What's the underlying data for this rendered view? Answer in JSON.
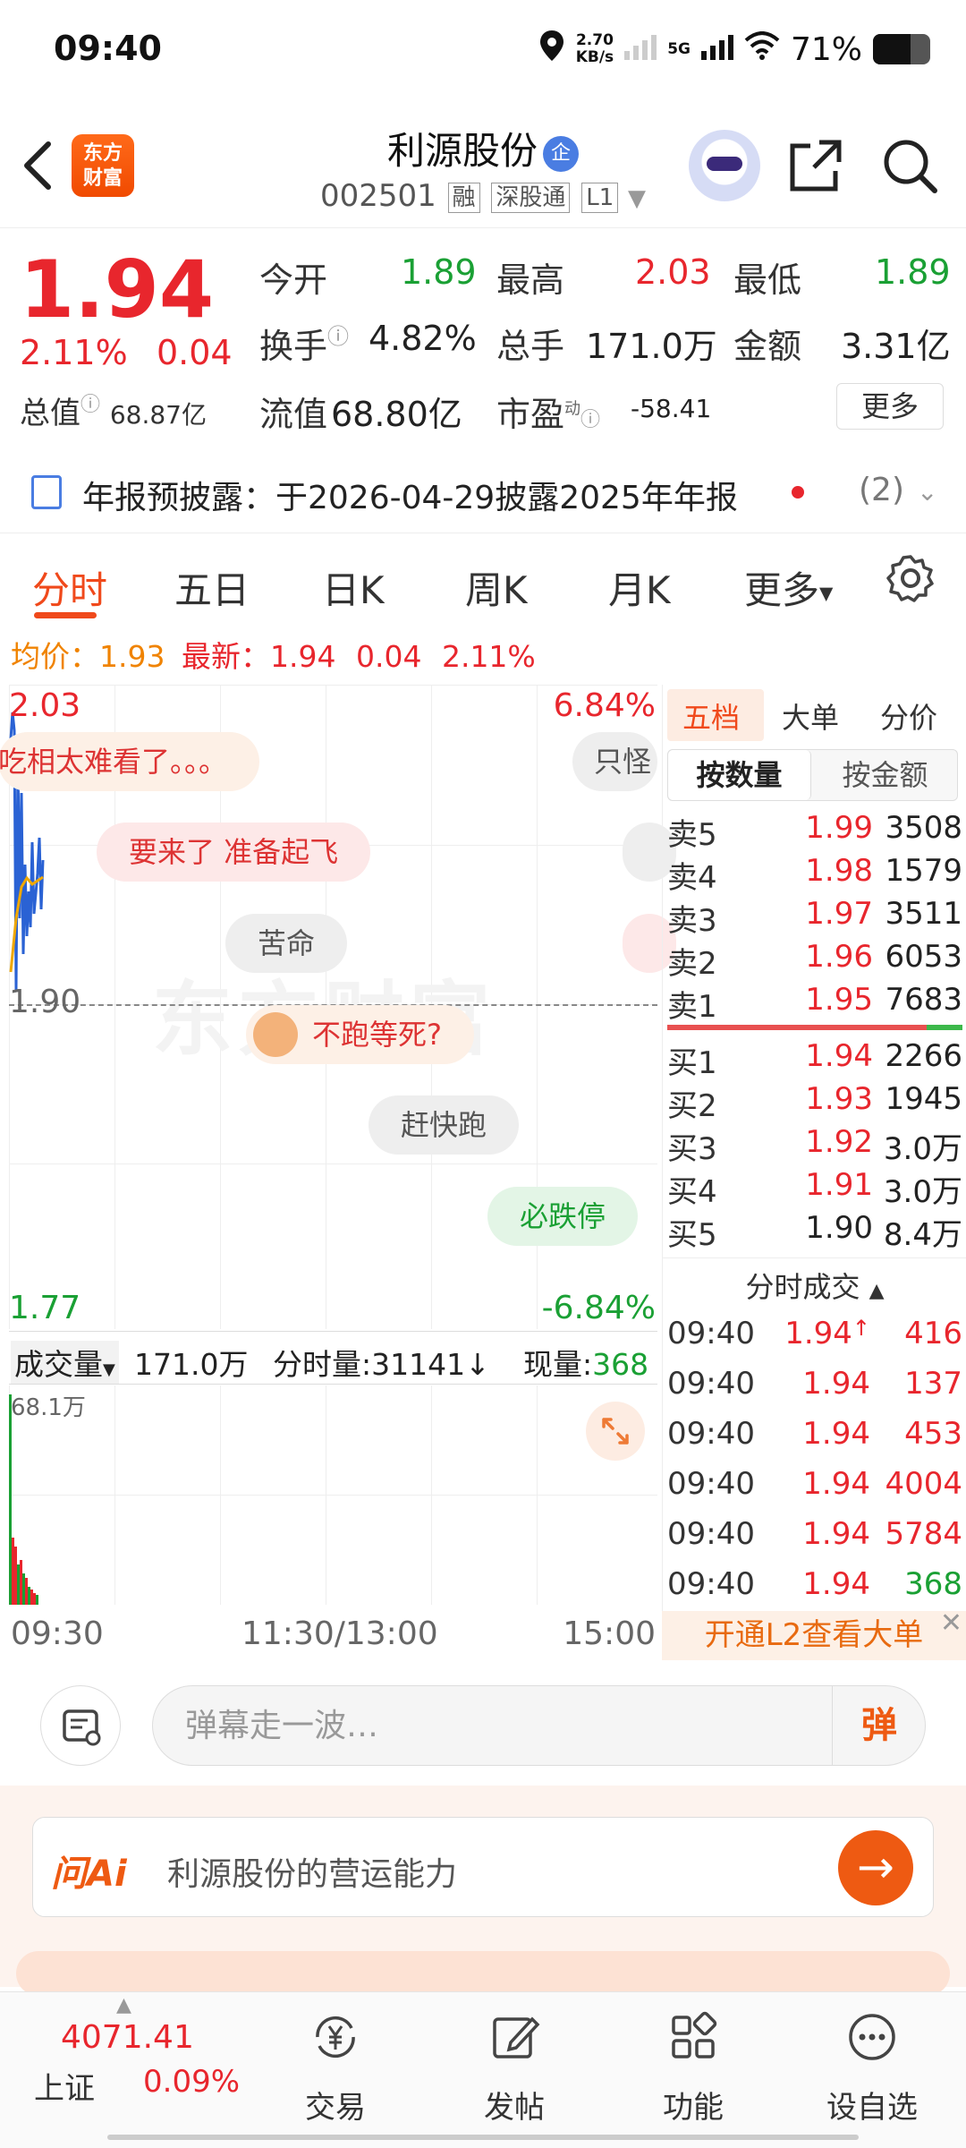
{
  "status_bar": {
    "time": "09:40",
    "net_speed_value": "2.70",
    "net_speed_unit": "KB/s",
    "network": "5G",
    "battery": "71%"
  },
  "header": {
    "logo_line1": "东方",
    "logo_line2": "财富",
    "stock_name": "利源股份",
    "stock_badge": "企",
    "stock_code": "002501",
    "tags": [
      "融",
      "深股通",
      "L1"
    ]
  },
  "quote": {
    "price": "1.94",
    "change_pct": "2.11%",
    "change": "0.04",
    "open_label": "今开",
    "open": "1.89",
    "high_label": "最高",
    "high": "2.03",
    "low_label": "最低",
    "low": "1.89",
    "turnover_label": "换手",
    "turnover": "4.82%",
    "volume_label": "总手",
    "volume": "171.0万",
    "amount_label": "金额",
    "amount": "3.31亿",
    "mktcap_label": "总值",
    "mktcap": "68.87亿",
    "float_label": "流值",
    "float_cap": "68.80亿",
    "pe_label": "市盈",
    "pe_sup": "动",
    "pe": "-58.41",
    "more_label": "更多"
  },
  "notice": {
    "text": "年报预披露：于2026-04-29披露2025年年报",
    "count": "(2)"
  },
  "chart_tabs": [
    "分时",
    "五日",
    "日K",
    "周K",
    "月K",
    "更多"
  ],
  "info_line": {
    "avg_label": "均价：",
    "avg": "1.93",
    "latest_label": "最新：",
    "latest": "1.94",
    "chg": "0.04",
    "pct": "2.11%"
  },
  "chart": {
    "y_top": "2.03",
    "pct_top": "6.84%",
    "y_mid": "1.90",
    "y_bottom": "1.77",
    "pct_bottom": "-6.84%",
    "watermark": "东方财富"
  },
  "danmu": [
    "吃相太难看了。。。",
    "只怪",
    "要来了 准备起飞",
    "苦命",
    "不跑等死?",
    "赶快跑",
    "必跌停"
  ],
  "volume_bar": {
    "label": "成交量",
    "total": "171.0万",
    "period_label": "分时量:",
    "period_value": "31141",
    "current_label": "现量:",
    "current_value": "368",
    "max_label": "68.1万"
  },
  "time_axis": [
    "09:30",
    "11:30/13:00",
    "15:00"
  ],
  "order_book": {
    "tabs": [
      "五档",
      "大单",
      "分价"
    ],
    "sub_tabs": [
      "按数量",
      "按金额"
    ],
    "sells": [
      {
        "label": "卖5",
        "price": "1.99",
        "vol": "3508"
      },
      {
        "label": "卖4",
        "price": "1.98",
        "vol": "1579"
      },
      {
        "label": "卖3",
        "price": "1.97",
        "vol": "3511"
      },
      {
        "label": "卖2",
        "price": "1.96",
        "vol": "6053"
      },
      {
        "label": "卖1",
        "price": "1.95",
        "vol": "7683"
      }
    ],
    "buys": [
      {
        "label": "买1",
        "price": "1.94",
        "vol": "2266"
      },
      {
        "label": "买2",
        "price": "1.93",
        "vol": "1945"
      },
      {
        "label": "买3",
        "price": "1.92",
        "vol": "3.0万"
      },
      {
        "label": "买4",
        "price": "1.91",
        "vol": "3.0万"
      },
      {
        "label": "买5",
        "price": "1.90",
        "vol": "8.4万"
      }
    ]
  },
  "trades": {
    "title": "分时成交",
    "rows": [
      {
        "time": "09:40",
        "price": "1.94",
        "vol": "416"
      },
      {
        "time": "09:40",
        "price": "1.94",
        "vol": "137"
      },
      {
        "time": "09:40",
        "price": "1.94",
        "vol": "453"
      },
      {
        "time": "09:40",
        "price": "1.94",
        "vol": "4004"
      },
      {
        "time": "09:40",
        "price": "1.94",
        "vol": "5784"
      },
      {
        "time": "09:40",
        "price": "1.94",
        "vol": "368"
      }
    ]
  },
  "l2_banner": "开通L2查看大单",
  "comment": {
    "placeholder": "弹幕走一波…",
    "danmu_btn": "弹"
  },
  "ai": {
    "logo": "问Ai",
    "prompt": "利源股份的营运能力"
  },
  "bottom_nav": {
    "index_value": "4071.41",
    "index_name": "上证",
    "index_pct": "0.09%",
    "items": [
      "交易",
      "发帖",
      "功能",
      "设自选"
    ]
  }
}
